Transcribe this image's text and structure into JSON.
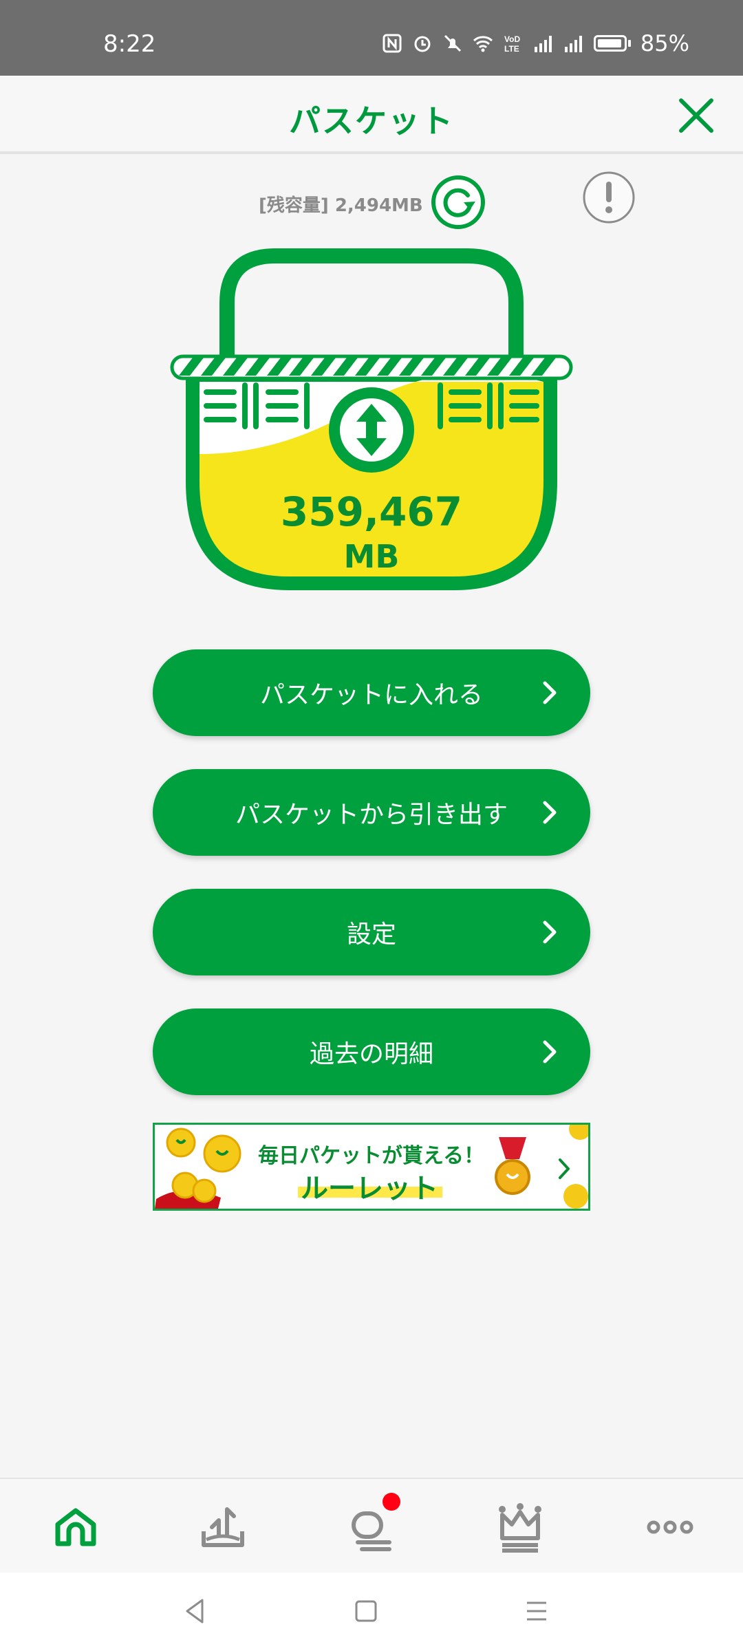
{
  "status_bar": {
    "time": "8:22",
    "battery": "85%",
    "icons": [
      "nfc-icon",
      "alarm-icon",
      "mute-icon",
      "wifi-icon",
      "volte-icon",
      "signal-icon",
      "signal-icon",
      "battery-icon"
    ]
  },
  "header": {
    "title": "パスケット",
    "close_icon": "close-icon"
  },
  "summary": {
    "remaining": "[残容量] 2,494MB",
    "refresh_icon": "refresh-icon",
    "info_icon": "info-icon"
  },
  "basket": {
    "value": "359,467",
    "unit": "MB",
    "icon": "basket-swap-icon"
  },
  "actions": [
    {
      "label": "パスケットに入れる"
    },
    {
      "label": "パスケットから引き出す"
    },
    {
      "label": "設定"
    },
    {
      "label": "過去の明細"
    }
  ],
  "banner": {
    "line1": "毎日パケットが貰える！",
    "line2": "ルーレット"
  },
  "bottom_nav": {
    "items": [
      "home-icon",
      "download-tray-icon",
      "chat-icon",
      "crown-icon",
      "more-icon"
    ],
    "chat_badge": true
  },
  "colors": {
    "brand_green": "#00a03e",
    "basket_yellow": "#f5e21c",
    "badge_red": "#ff0014"
  }
}
